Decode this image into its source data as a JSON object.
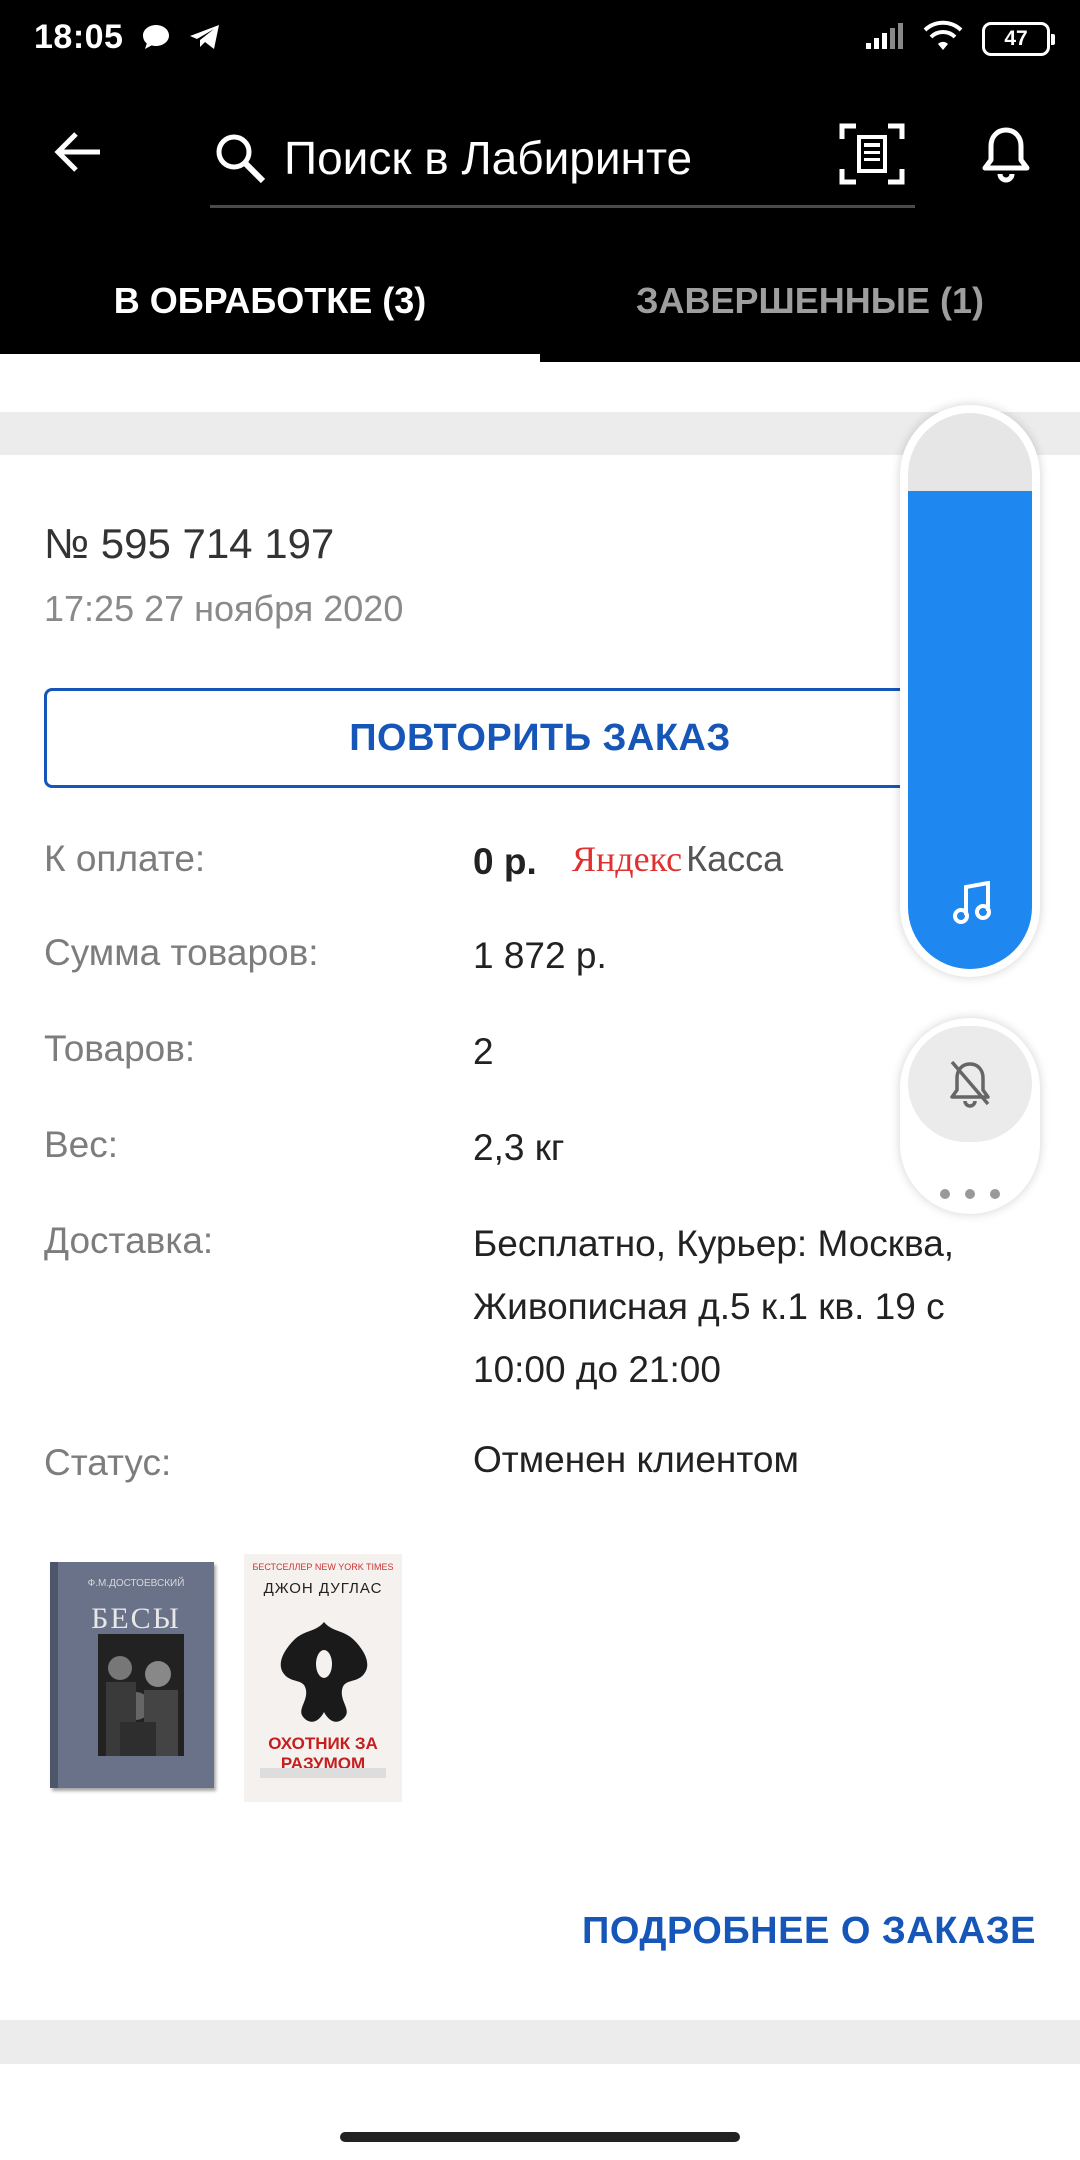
{
  "status_bar": {
    "time": "18:05",
    "battery": "47"
  },
  "search": {
    "placeholder": "Поиск в Лабиринте"
  },
  "tabs": [
    {
      "label": "В ОБРАБОТКЕ (3)",
      "active": true
    },
    {
      "label": "ЗАВЕРШЕННЫЕ (1)",
      "active": false
    }
  ],
  "order": {
    "number": "№ 595 714 197",
    "date": "17:25 27 ноября 2020",
    "repeat_label": "ПОВТОРИТЬ ЗАКАЗ",
    "rows": [
      {
        "label": "К оплате:",
        "value": "0 р."
      },
      {
        "label": "Сумма товаров:",
        "value": "1 872 р."
      },
      {
        "label": "Товаров:",
        "value": "2"
      },
      {
        "label": "Вес:",
        "value": "2,3 кг"
      },
      {
        "label": "Доставка:",
        "value": "Бесплатно, Курьер: Москва, Живописная д.5 к.1 кв. 19 с 10:00 до 21:00"
      },
      {
        "label": "Статус:",
        "value": "Отменен клиентом"
      }
    ],
    "payment_logo": {
      "part1": "Яндекс",
      "part2": "Касса"
    },
    "books": [
      {
        "author": "Ф.М.ДОСТОЕВСКИЙ",
        "title": "БЕСЫ"
      },
      {
        "top_line": "БЕСТСЕЛЛЕР NEW YORK TIMES",
        "author": "ДЖОН ДУГЛАС",
        "title": "ОХОТНИК ЗА РАЗУМОМ"
      }
    ],
    "details_label": "ПОДРОБНЕЕ О ЗАКАЗЕ"
  },
  "volume": {
    "level_percent": 86
  },
  "colors": {
    "accent": "#1656b8",
    "volume": "#1e87f0",
    "header": "#000000"
  }
}
